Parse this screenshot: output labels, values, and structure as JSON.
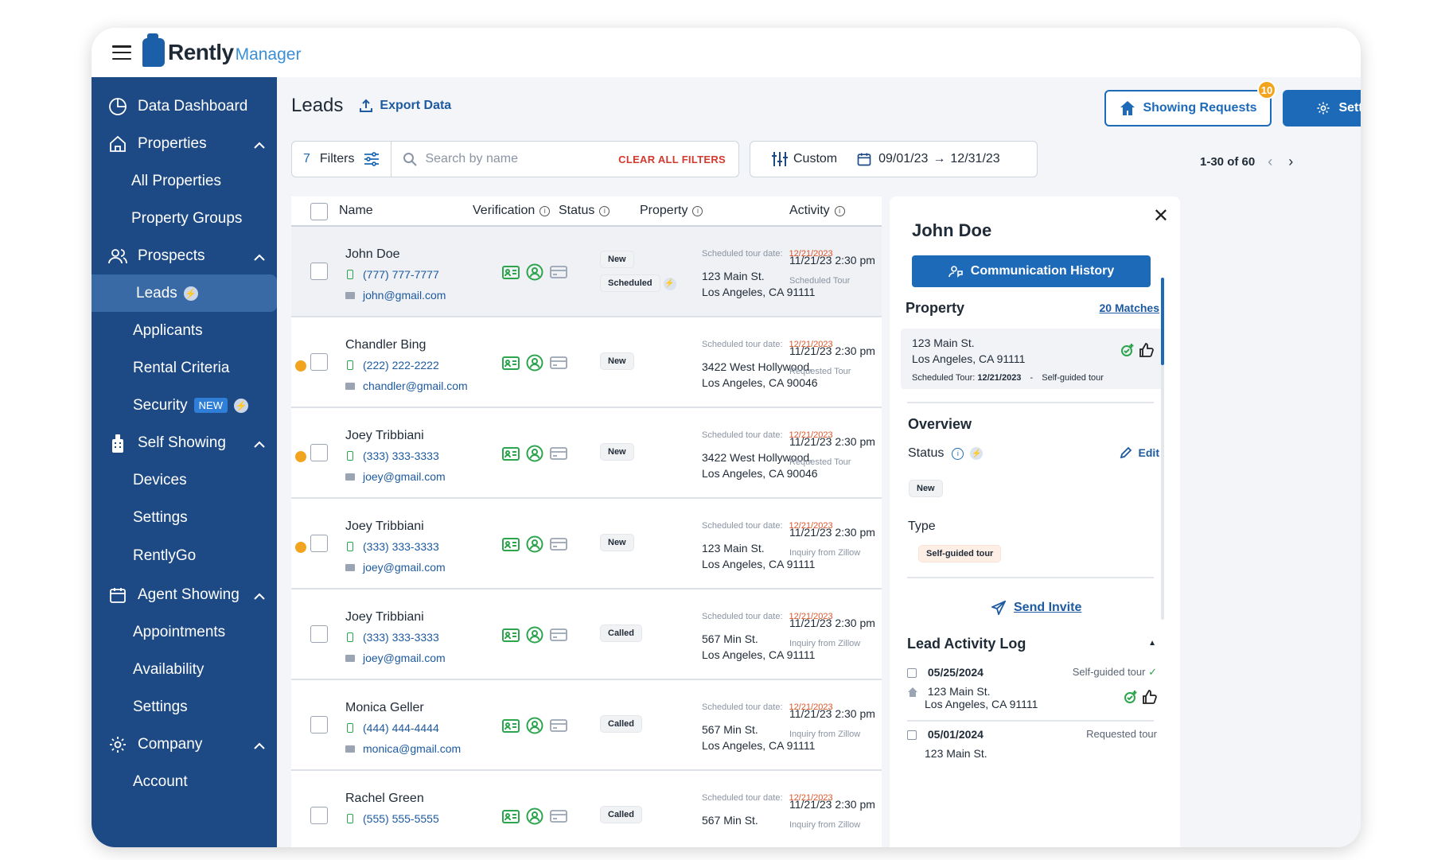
{
  "app": {
    "brand_main": "Rently",
    "brand_sub": "Manager"
  },
  "sidebar": {
    "data_dashboard": "Data Dashboard",
    "properties": "Properties",
    "all_properties": "All Properties",
    "property_groups": "Property Groups",
    "prospects": "Prospects",
    "leads": "Leads",
    "applicants": "Applicants",
    "rental_criteria": "Rental Criteria",
    "security": "Security",
    "security_badge": "NEW",
    "self_showing": "Self Showing",
    "devices": "Devices",
    "settings": "Settings",
    "rentlygo": "RentlyGo",
    "agent_showing": "Agent Showing",
    "appointments": "Appointments",
    "availability": "Availability",
    "settings2": "Settings",
    "company": "Company",
    "account": "Account"
  },
  "header": {
    "title": "Leads",
    "export": "Export Data",
    "showing_requests": "Showing Requests",
    "showing_count": "10",
    "settings": "Settings"
  },
  "filters": {
    "count": "7",
    "label": "Filters",
    "search_placeholder": "Search by name",
    "clear_all": "CLEAR ALL FILTERS",
    "custom": "Custom",
    "date_from": "09/01/23",
    "date_to": "12/31/23",
    "pager": "1-30 of 60"
  },
  "columns": {
    "name": "Name",
    "verification": "Verification",
    "status": "Status",
    "property": "Property",
    "activity": "Activity"
  },
  "rows": [
    {
      "name": "John Doe",
      "phone": "(777) 777-7777",
      "email": "john@gmail.com",
      "status1": "New",
      "status2": "Scheduled",
      "tour_label": "Scheduled tour date:",
      "tour_date": "12/21/2023",
      "addr1": "123 Main St.",
      "addr2": "Los Angeles, CA 91111",
      "time": "11/21/23  2:30 pm",
      "note": "Scheduled Tour"
    },
    {
      "name": "Chandler Bing",
      "phone": "(222) 222-2222",
      "email": "chandler@gmail.com",
      "status1": "New",
      "tour_label": "Scheduled tour date:",
      "tour_date": "12/21/2023",
      "addr1": "3422 West Hollywood,",
      "addr2": "Los Angeles, CA 90046",
      "time": "11/21/23  2:30 pm",
      "note": "Requested Tour"
    },
    {
      "name": "Joey Tribbiani",
      "phone": "(333) 333-3333",
      "email": "joey@gmail.com",
      "status1": "New",
      "tour_label": "Scheduled tour date:",
      "tour_date": "12/21/2023",
      "addr1": "3422 West Hollywood,",
      "addr2": "Los Angeles, CA 90046",
      "time": "11/21/23  2:30 pm",
      "note": "Requested Tour"
    },
    {
      "name": "Joey Tribbiani",
      "phone": "(333) 333-3333",
      "email": "joey@gmail.com",
      "status1": "New",
      "tour_label": "Scheduled tour date:",
      "tour_date": "12/21/2023",
      "addr1": "123 Main St.",
      "addr2": "Los Angeles, CA 91111",
      "time": "11/21/23  2:30 pm",
      "note": "Inquiry from Zillow"
    },
    {
      "name": "Joey Tribbiani",
      "phone": "(333) 333-3333",
      "email": "joey@gmail.com",
      "status1": "Called",
      "tour_label": "Scheduled tour date:",
      "tour_date": "12/21/2023",
      "addr1": "567 Min St.",
      "addr2": "Los Angeles, CA 91111",
      "time": "11/21/23  2:30 pm",
      "note": "Inquiry from Zillow"
    },
    {
      "name": "Monica Geller",
      "phone": "(444) 444-4444",
      "email": "monica@gmail.com",
      "status1": "Called",
      "tour_label": "Scheduled tour date:",
      "tour_date": "12/21/2023",
      "addr1": "567 Min St.",
      "addr2": "Los Angeles, CA 91111",
      "time": "11/21/23  2:30 pm",
      "note": "Inquiry from Zillow"
    },
    {
      "name": "Rachel Green",
      "phone": "(555) 555-5555",
      "email": "",
      "status1": "Called",
      "tour_label": "Scheduled tour date:",
      "tour_date": "12/21/2023",
      "addr1": "567 Min St.",
      "addr2": "",
      "time": "11/21/23  2:30 pm",
      "note": "Inquiry from Zillow"
    }
  ],
  "panel": {
    "name": "John Doe",
    "comm_history": "Communication History",
    "property_title": "Property",
    "matches": "20 Matches",
    "prop_addr1": "123 Main St.",
    "prop_addr2": "Los Angeles, CA 91111",
    "prop_tour_label": "Scheduled Tour:",
    "prop_tour_date": "12/21/2023",
    "prop_tour_sep": "-",
    "prop_tour_type": "Self-guided tour",
    "overview": "Overview",
    "status_label": "Status",
    "edit": "Edit",
    "status_value": "New",
    "type_label": "Type",
    "type_value": "Self-guided tour",
    "send_invite": "Send Invite",
    "log_title": "Lead Activity Log",
    "log1_date": "05/25/2024",
    "log1_type": "Self-guided tour",
    "log1_addr1": "123 Main St.",
    "log1_addr2": "Los Angeles, CA 91111",
    "log2_date": "05/01/2024",
    "log2_type": "Requested tour",
    "log2_addr1": "123 Main St."
  },
  "colors": {
    "brand": "#1d4a85",
    "accent": "#1d6ab8",
    "warning": "#f2a41f",
    "date_red": "#e0542a",
    "verified_green": "#2da44e"
  }
}
